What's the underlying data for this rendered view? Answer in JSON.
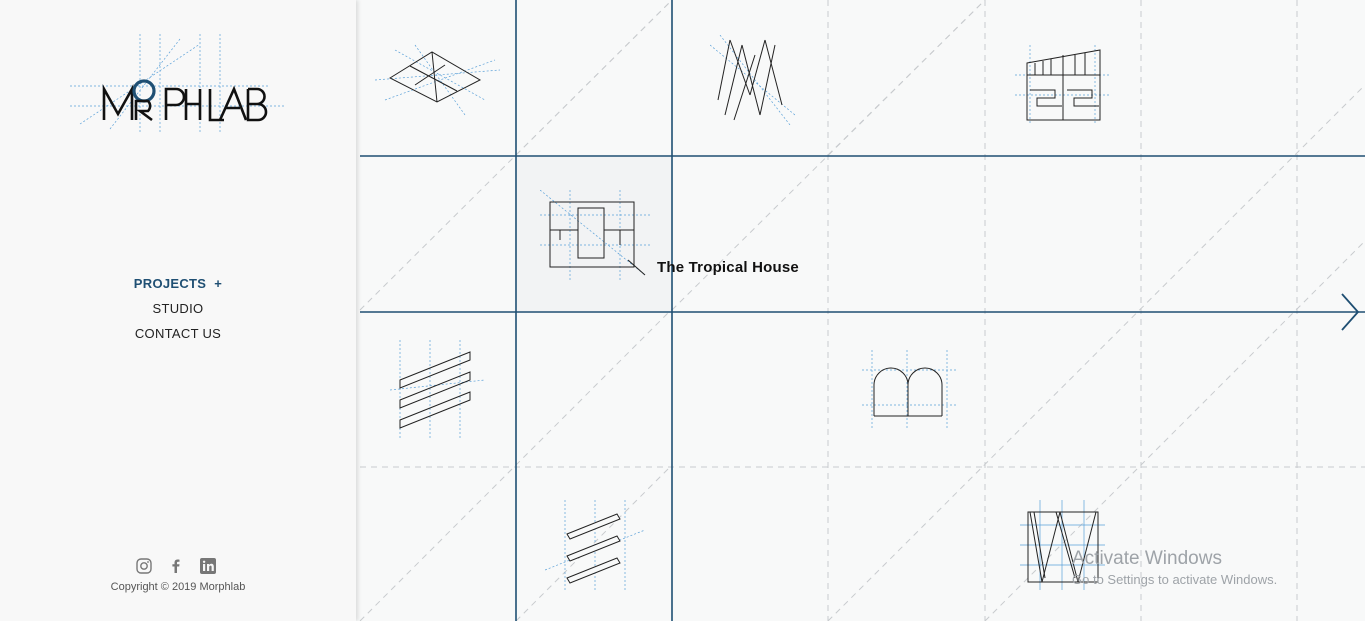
{
  "brand": {
    "logo_text": "MORPHLAB"
  },
  "nav": {
    "items": [
      {
        "label": "PROJECTS",
        "suffix": "+",
        "active": true
      },
      {
        "label": "STUDIO",
        "active": false
      },
      {
        "label": "CONTACT US",
        "active": false
      }
    ]
  },
  "social": {
    "icons": [
      "instagram-icon",
      "facebook-icon",
      "linkedin-icon"
    ]
  },
  "footer": {
    "copyright": "Copyright © 2019 Morphlab"
  },
  "gallery": {
    "hovered_project_title": "The Tropical House",
    "next_icon": "chevron-right-icon"
  },
  "os_watermark": {
    "title": "Activate Windows",
    "subtitle": "Go to Settings to activate Windows."
  },
  "colors": {
    "accent": "#1f4f73",
    "grid_line": "#1f4f73",
    "dashed_line": "#c8cbce",
    "sketch_blue": "#5aa0d8",
    "sketch_ink": "#222222"
  }
}
